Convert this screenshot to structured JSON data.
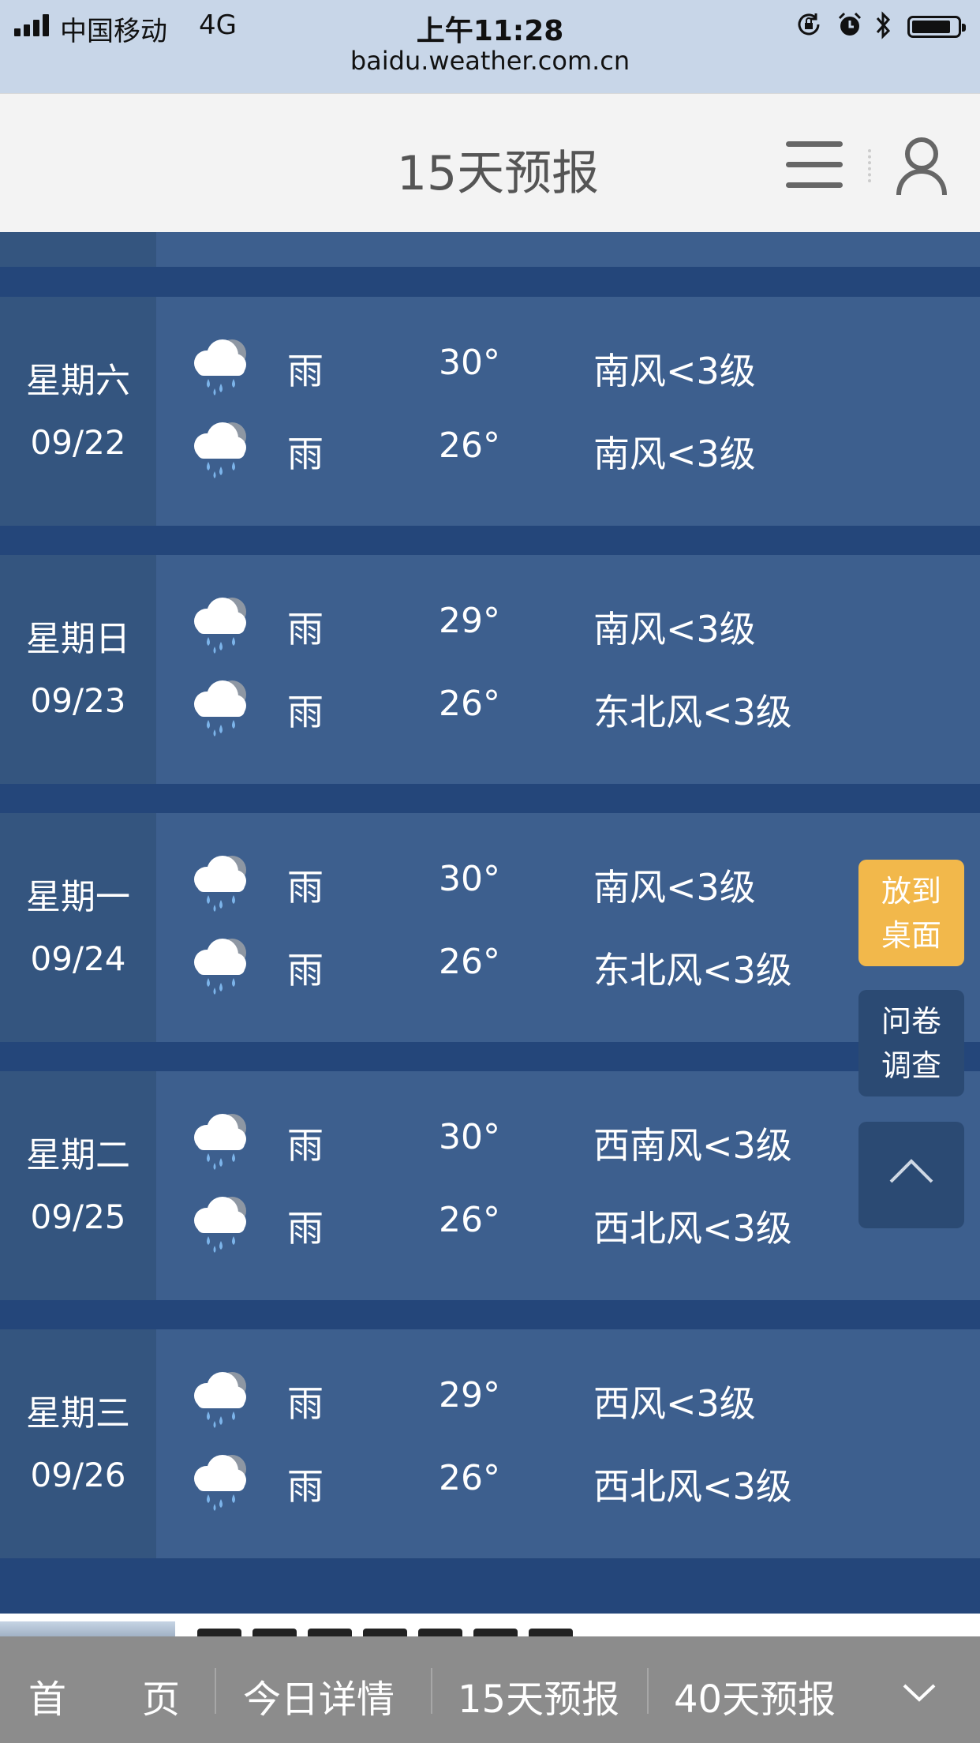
{
  "status_bar": {
    "carrier": "中国移动",
    "network": "4G",
    "time": "上午11:28",
    "url": "baidu.weather.com.cn",
    "battery_level": 0.85
  },
  "header": {
    "title": "15天预报",
    "menu_icon": "hamburger-menu-icon",
    "user_icon": "user-profile-icon"
  },
  "forecast": [
    {
      "weekday": "星期六",
      "date": "09/22",
      "day": {
        "icon": "rain-cloud-icon",
        "weather": "雨",
        "temp": "30°",
        "wind": "南风<3级"
      },
      "night": {
        "icon": "rain-cloud-icon",
        "weather": "雨",
        "temp": "26°",
        "wind": "南风<3级"
      }
    },
    {
      "weekday": "星期日",
      "date": "09/23",
      "day": {
        "icon": "rain-cloud-icon",
        "weather": "雨",
        "temp": "29°",
        "wind": "南风<3级"
      },
      "night": {
        "icon": "rain-cloud-icon",
        "weather": "雨",
        "temp": "26°",
        "wind": "东北风<3级"
      }
    },
    {
      "weekday": "星期一",
      "date": "09/24",
      "day": {
        "icon": "rain-cloud-icon",
        "weather": "雨",
        "temp": "30°",
        "wind": "南风<3级"
      },
      "night": {
        "icon": "rain-cloud-icon",
        "weather": "雨",
        "temp": "26°",
        "wind": "东北风<3级"
      }
    },
    {
      "weekday": "星期二",
      "date": "09/25",
      "day": {
        "icon": "rain-cloud-icon",
        "weather": "雨",
        "temp": "30°",
        "wind": "西南风<3级"
      },
      "night": {
        "icon": "rain-cloud-icon",
        "weather": "雨",
        "temp": "26°",
        "wind": "西北风<3级"
      }
    },
    {
      "weekday": "星期三",
      "date": "09/26",
      "day": {
        "icon": "rain-cloud-icon",
        "weather": "雨",
        "temp": "29°",
        "wind": "西风<3级"
      },
      "night": {
        "icon": "rain-cloud-icon",
        "weather": "雨",
        "temp": "26°",
        "wind": "西北风<3级"
      }
    }
  ],
  "side_buttons": {
    "add_to_desktop": [
      "放到",
      "桌面"
    ],
    "survey": [
      "问卷",
      "调查"
    ],
    "back_to_top_icon": "chevron-up-icon"
  },
  "bottom_nav": {
    "items": [
      "首　　页",
      "今日详情",
      "15天预报",
      "40天预报"
    ],
    "more_icon": "chevron-down-icon"
  },
  "colors": {
    "background": "#24467a",
    "row": "#3d5f8e",
    "date_column": "#34557f",
    "desktop_button": "#f2b84b",
    "side_button": "#2b4a73",
    "bottom_nav": "#8c8c8c"
  }
}
